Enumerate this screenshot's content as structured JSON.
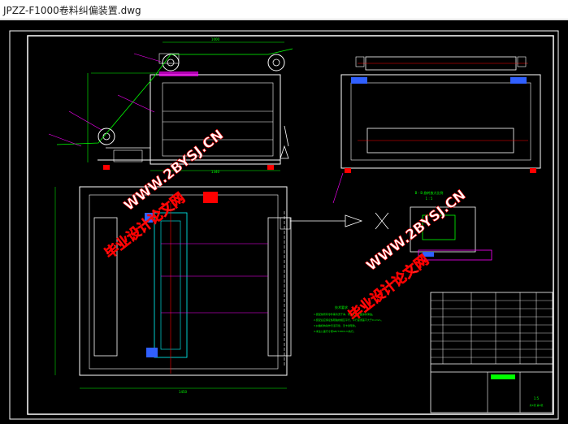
{
  "window": {
    "title": "JPZZ-F1000卷料纠偏装置.dwg"
  },
  "watermark": {
    "url": "WWW.2BYSJ.CN",
    "cn": "毕业设计论文网"
  },
  "drawing": {
    "section_label": "B - B 旋转放大比例",
    "section_sub": "1 : 5",
    "tech_title": "技术要求",
    "tech_lines": [
      "1.装配前所有零件需清洗干净，所有配合表面涂润滑油。",
      "2.装配后应保证各辊轴线相互平行，平行度误差不大于0.1mm。",
      "3.纠偏机构动作灵活可靠，无卡滞现象。",
      "4.未注公差尺寸按GB/T1804-m执行。"
    ],
    "dims": {
      "top_width": "1000",
      "bottom_width": "1450",
      "mid_width": "1340",
      "left_height": "920"
    },
    "title_block": {
      "scale": "1:5",
      "sheet": "共1张 第1张"
    }
  },
  "colors": {
    "frame": "#ffffff",
    "green": "#00ff00",
    "cyan": "#00ffff",
    "red": "#ff0000",
    "magenta": "#ff00ff",
    "yellow": "#ffff00",
    "blue": "#3060ff"
  }
}
